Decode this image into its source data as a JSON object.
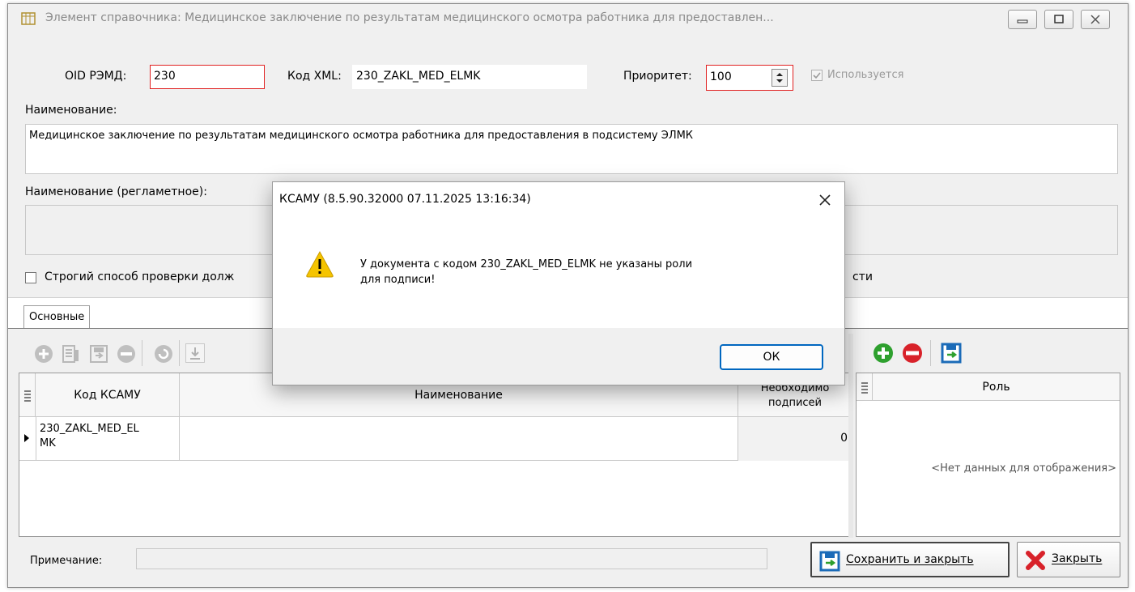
{
  "window": {
    "title": "Элемент справочника: Медицинское заключение по результатам медицинского осмотра работника для предоставлен..."
  },
  "form": {
    "oid_label": "OID РЭМД:",
    "oid_value": "230",
    "xml_label": "Код XML:",
    "xml_value": "230_ZAKL_MED_ELMK",
    "priority_label": "Приоритет:",
    "priority_value": "100",
    "used_label": "Используется",
    "name_label": "Наименование:",
    "name_value": "Медицинское заключение по результатам медицинского осмотра работника для предоставления в подсистему ЭЛМК",
    "reg_name_label": "Наименование (регламетное):",
    "reg_name_value": "",
    "strict_label": "Строгий способ проверки долж",
    "strict_tail": "сти"
  },
  "tabs": [
    {
      "label": "Основные"
    }
  ],
  "left_grid": {
    "columns": [
      "Код КСАМУ",
      "Наименование",
      "Необходимо подписей"
    ],
    "col3_top": "Необходимо",
    "col3_bottom": "подписей",
    "rows": [
      {
        "code_line1": "230_ZAKL_MED_EL",
        "code_line2": "MK",
        "name": "",
        "count": "0"
      }
    ]
  },
  "right_grid": {
    "columns": [
      "Роль"
    ],
    "empty_text": "<Нет данных для отображения>"
  },
  "footer": {
    "note_label": "Примечание:",
    "note_value": "",
    "save_label": "Сохранить и закрыть",
    "close_label": "Закрыть"
  },
  "dialog": {
    "title": "КСАМУ (8.5.90.32000 07.11.2025 13:16:34)",
    "message_line1": "У документа с кодом 230_ZAKL_MED_ELMK не указаны роли",
    "message_line2": "для подписи!",
    "ok_label": "ОК"
  },
  "colors": {
    "accent": "#0067c0",
    "invalid_border": "#e02020",
    "add_green": "#2ea02e",
    "remove_red": "#d8222a",
    "warning_yellow": "#f5c400"
  }
}
